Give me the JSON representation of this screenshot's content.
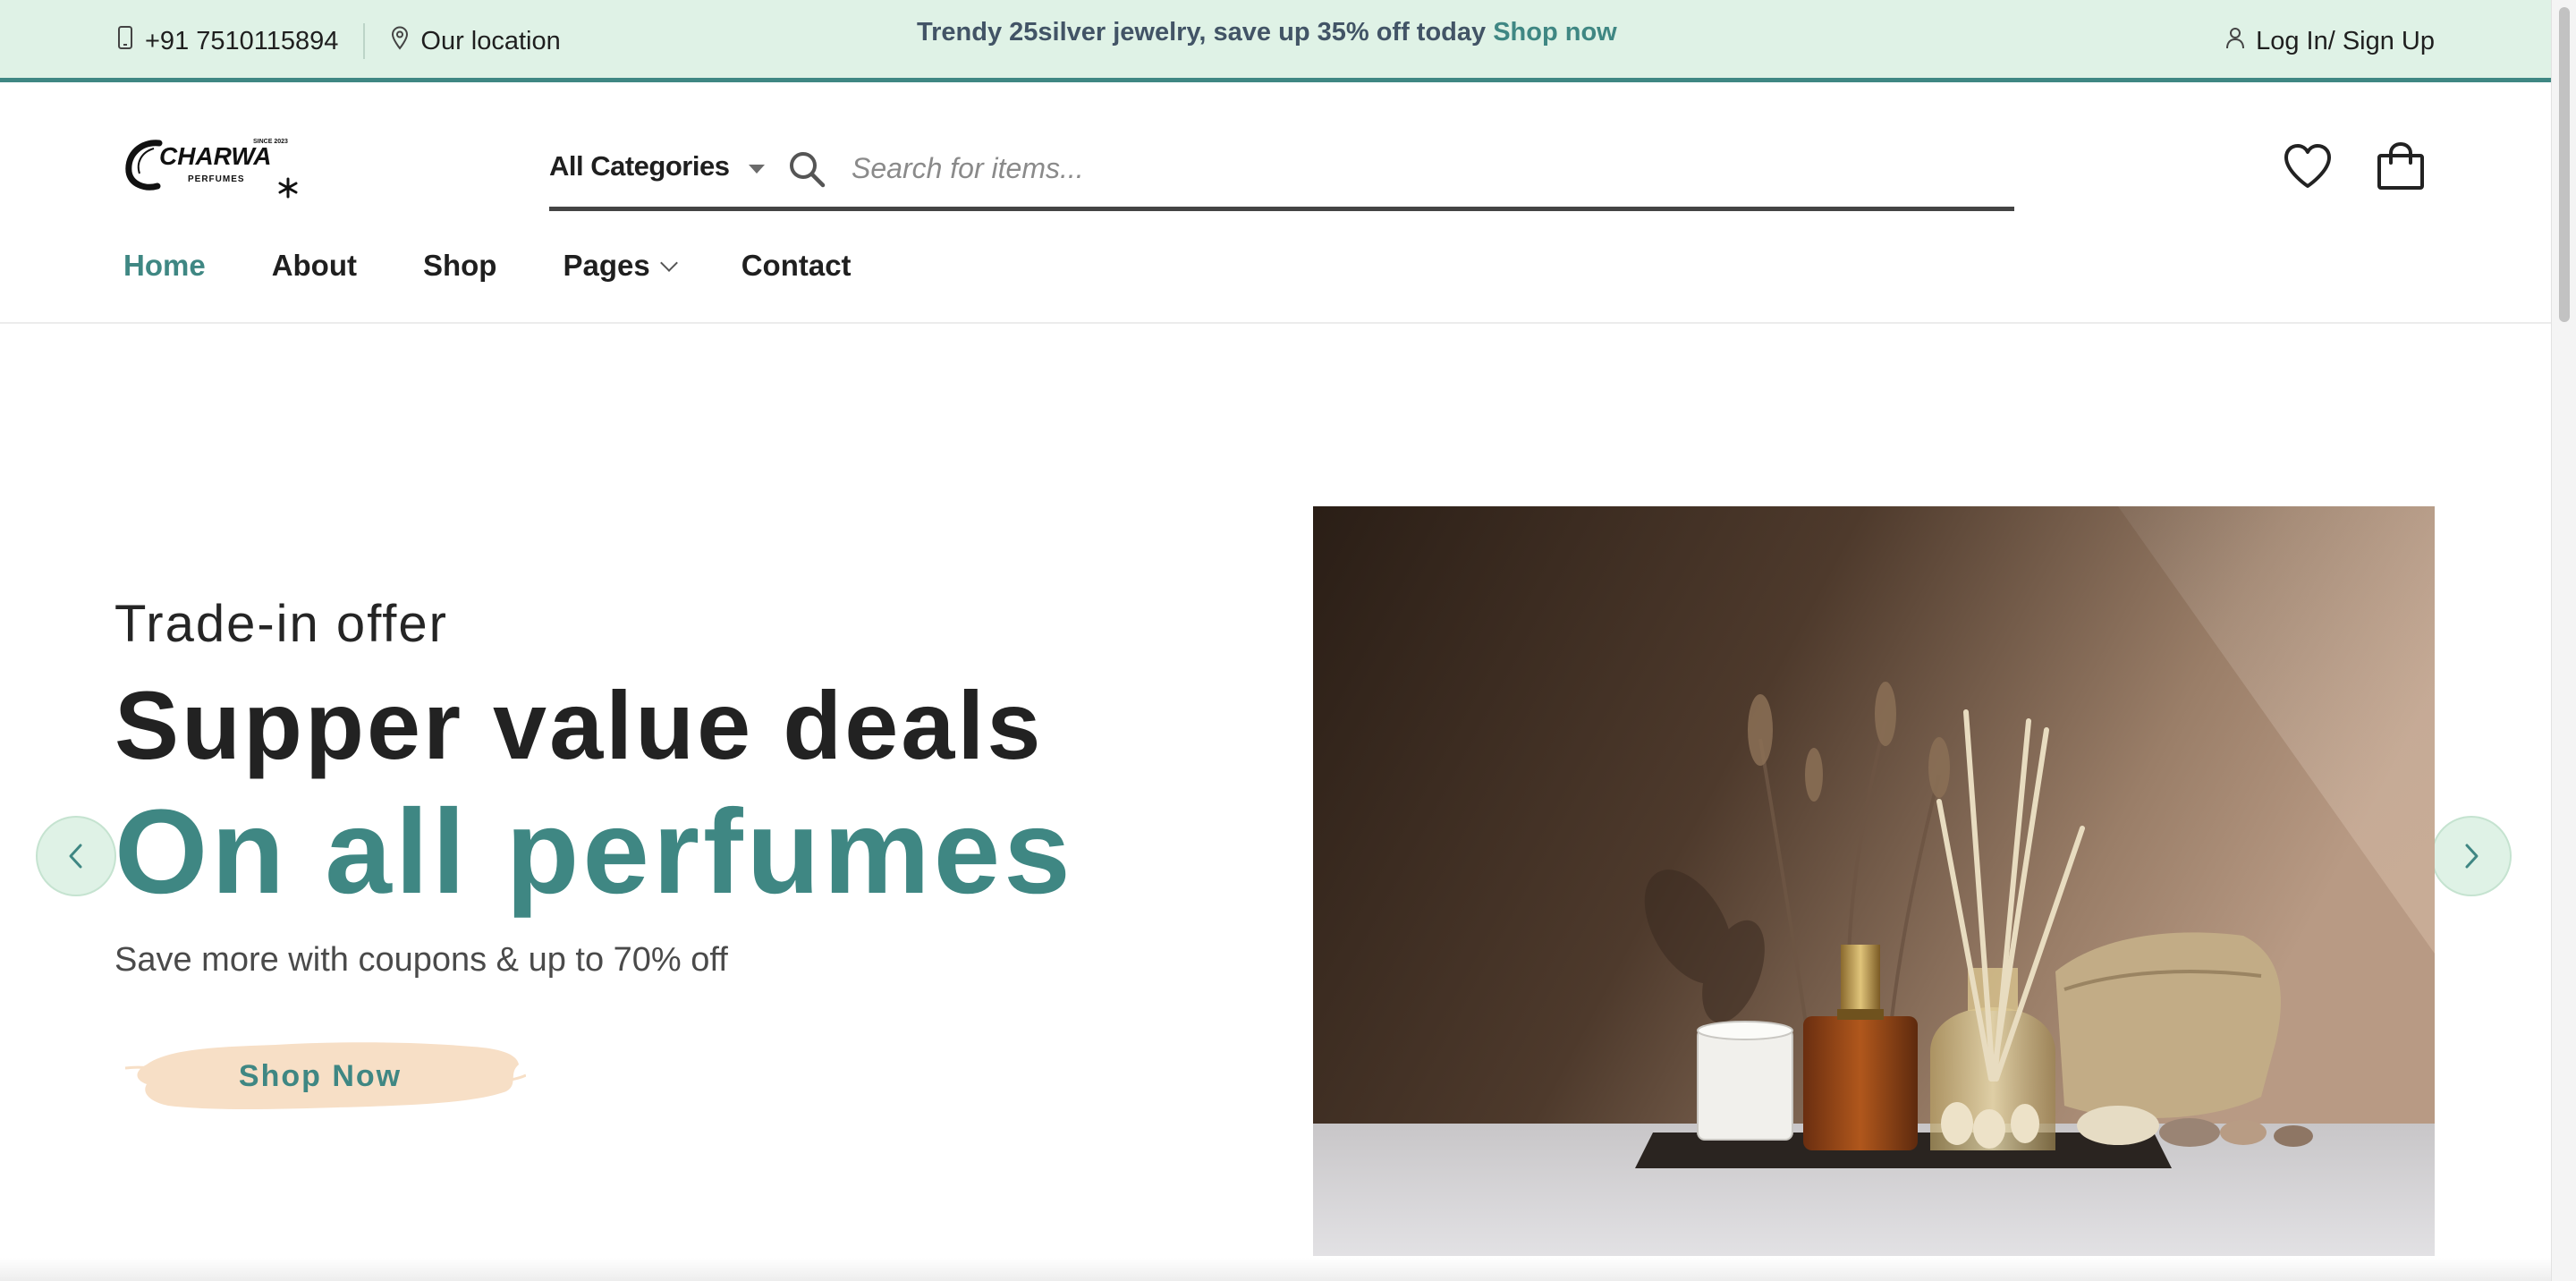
{
  "topbar": {
    "phone": "+91 7510115894",
    "location": "Our location",
    "promo_text": "Trendy 25silver jewelry, save up 35% off today",
    "promo_link": "Shop now",
    "login": "Log In/ Sign Up",
    "icons": {
      "phone": "phone-icon",
      "location": "location-pin-icon",
      "user": "user-icon"
    }
  },
  "header": {
    "logo_text": "CHARWA",
    "logo_sub": "PERFUMES",
    "logo_since": "SINCE 2023",
    "category_label": "All Categories",
    "search_placeholder": "Search for items...",
    "icons": {
      "wishlist": "heart-icon",
      "cart": "shopping-bag-icon",
      "search": "search-icon"
    }
  },
  "nav": {
    "items": [
      {
        "label": "Home"
      },
      {
        "label": "About"
      },
      {
        "label": "Shop"
      },
      {
        "label": "Pages"
      },
      {
        "label": "Contact"
      }
    ],
    "active_index": 0
  },
  "hero": {
    "kicker": "Trade-in offer",
    "title": "Supper value deals",
    "title_accent": "On all perfumes",
    "subtitle": "Save more with coupons & up to 70% off",
    "cta": "Shop Now"
  },
  "colors": {
    "accent": "#3f8783",
    "topbar_bg": "#dff2e6",
    "cta_brush": "#f7dfc6"
  }
}
